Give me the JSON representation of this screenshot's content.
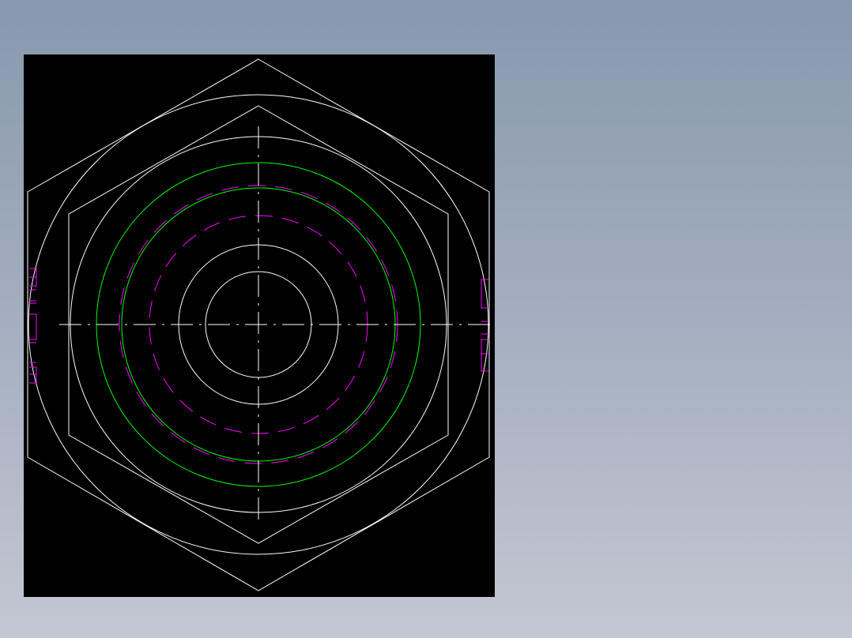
{
  "colors": {
    "background": "#000000",
    "geometry": "#ffffff",
    "thread_circles": "#00ff00",
    "hidden_lines": "#ff00ff"
  },
  "view": {
    "type": "cad-drawing",
    "subject": "hex-nut-top-view"
  }
}
